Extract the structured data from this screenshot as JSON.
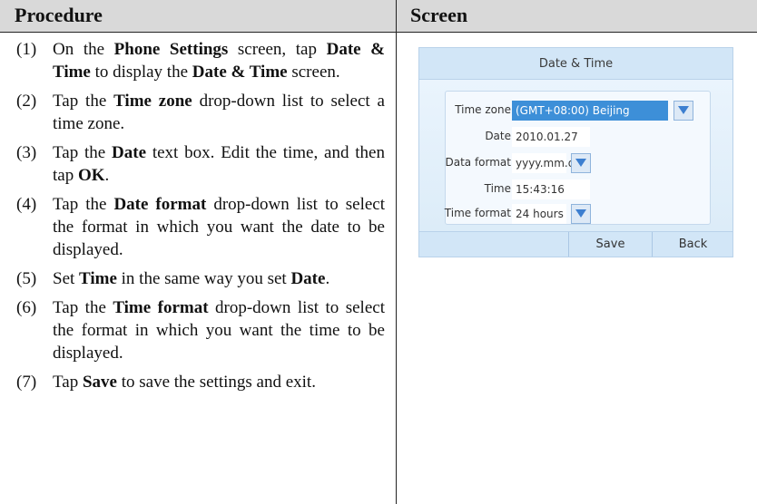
{
  "table": {
    "header_procedure": "Procedure",
    "header_screen": "Screen"
  },
  "steps": [
    {
      "num": "(1)",
      "parts": [
        [
          "On the ",
          false
        ],
        [
          "Phone Settings",
          true
        ],
        [
          " screen, tap ",
          false
        ],
        [
          "Date & Time",
          true
        ],
        [
          " to display the ",
          false
        ],
        [
          "Date & Time",
          true
        ],
        [
          " screen.",
          false
        ]
      ]
    },
    {
      "num": "(2)",
      "parts": [
        [
          "Tap the ",
          false
        ],
        [
          "Time zone",
          true
        ],
        [
          " drop-down list to select a time zone.",
          false
        ]
      ]
    },
    {
      "num": "(3)",
      "parts": [
        [
          "Tap the ",
          false
        ],
        [
          "Date",
          true
        ],
        [
          " text box. Edit the time, and then tap ",
          false
        ],
        [
          "OK",
          true
        ],
        [
          ".",
          false
        ]
      ]
    },
    {
      "num": "(4)",
      "parts": [
        [
          "Tap the ",
          false
        ],
        [
          "Date format",
          true
        ],
        [
          " drop-down list to select the format in which you want the date to be displayed.",
          false
        ]
      ]
    },
    {
      "num": "(5)",
      "parts": [
        [
          "Set ",
          false
        ],
        [
          "Time",
          true
        ],
        [
          " in the same way you set ",
          false
        ],
        [
          "Date",
          true
        ],
        [
          ".",
          false
        ]
      ]
    },
    {
      "num": "(6)",
      "parts": [
        [
          "Tap the ",
          false
        ],
        [
          "Time format",
          true
        ],
        [
          " drop-down list to select the format in which you want the time to be displayed.",
          false
        ]
      ]
    },
    {
      "num": "(7)",
      "parts": [
        [
          "Tap ",
          false
        ],
        [
          "Save",
          true
        ],
        [
          " to save the settings and exit.",
          false
        ]
      ]
    }
  ],
  "screen": {
    "title": "Date & Time",
    "fields": {
      "time_zone_label": "Time zone",
      "time_zone_value": "(GMT+08:00) Beijing",
      "date_label": "Date",
      "date_value": "2010.01.27",
      "data_format_label": "Data format",
      "data_format_value": "yyyy.mm.dd",
      "time_label": "Time",
      "time_value": "15:43:16",
      "time_format_label": "Time format",
      "time_format_value": "24 hours"
    },
    "buttons": {
      "save": "Save",
      "back": "Back"
    },
    "icons": {
      "dropdown": "triangle-down-icon"
    },
    "colors": {
      "selected_field": "#3d8fd8",
      "title_bar": "#d2e6f7"
    }
  }
}
